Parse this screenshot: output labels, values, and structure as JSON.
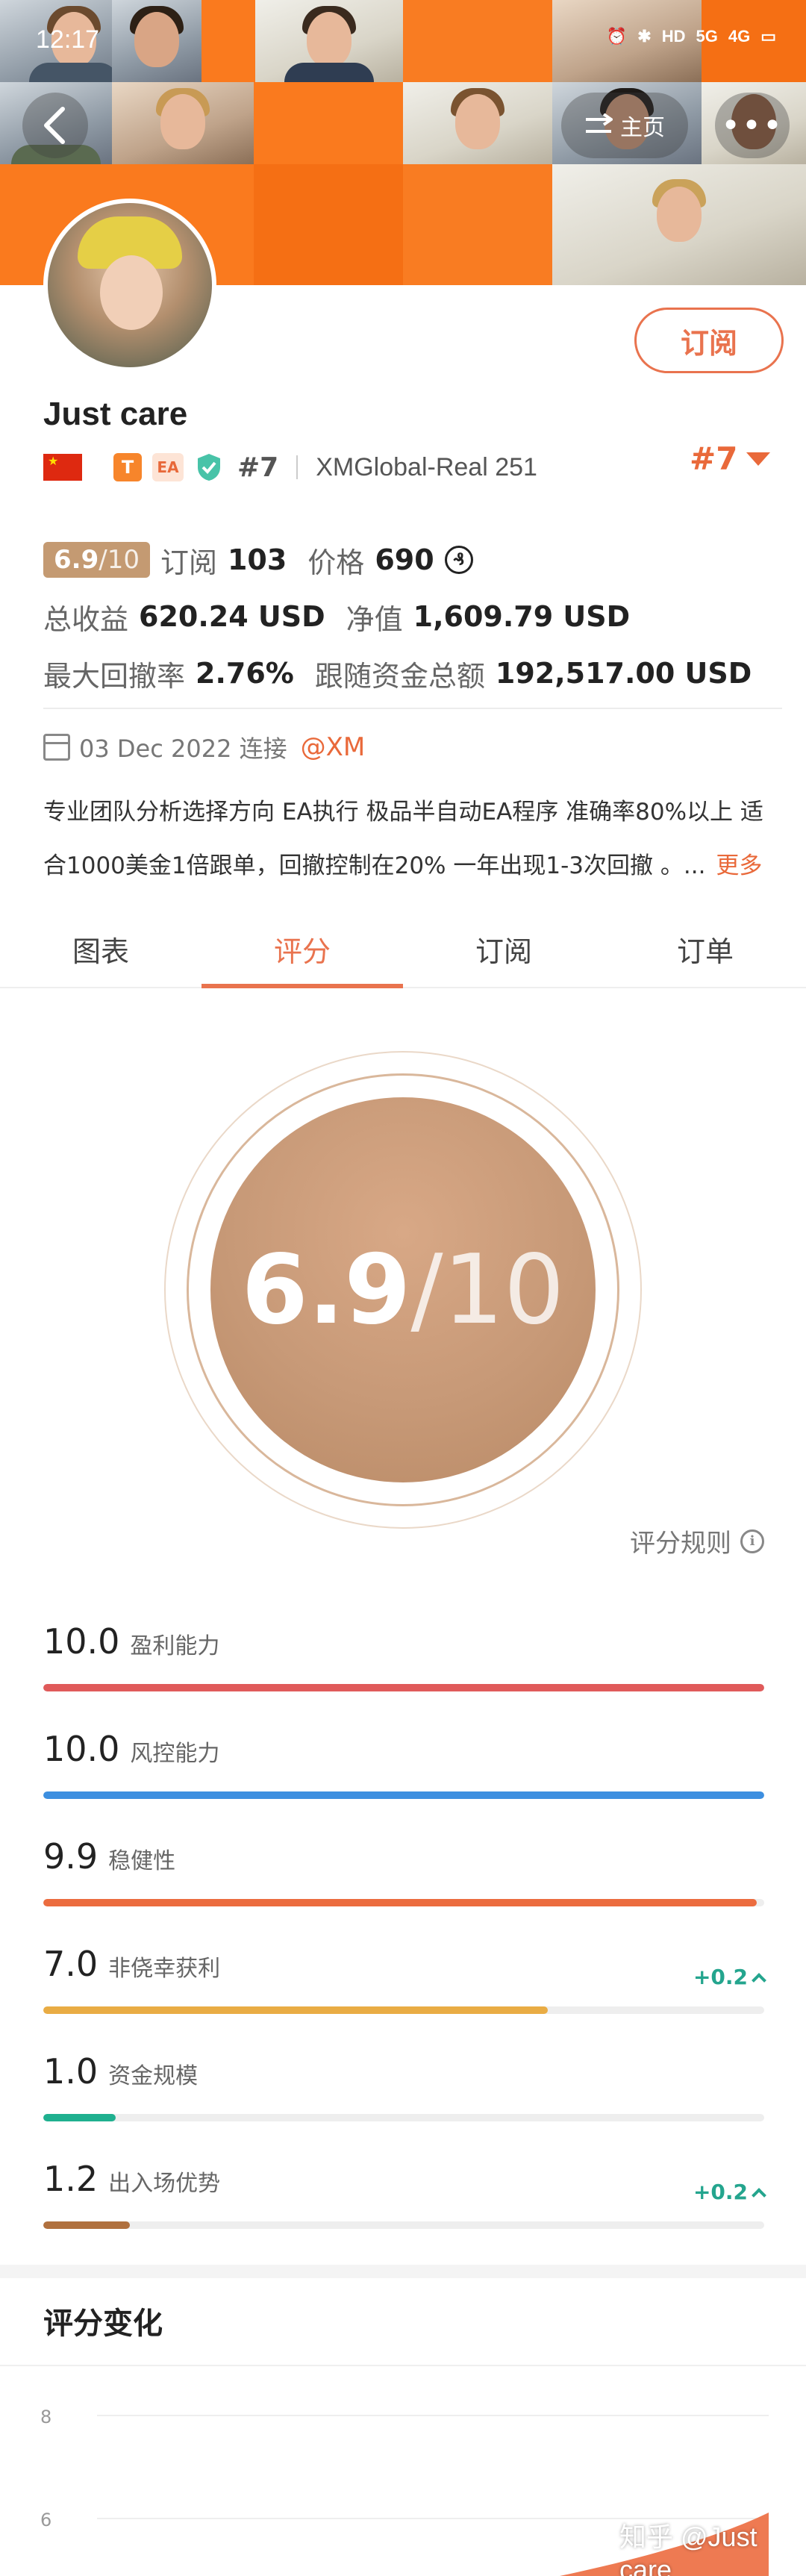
{
  "status_bar": {
    "time": "12:17",
    "icons": [
      "alarm-icon",
      "bluetooth-icon",
      "hd-icon",
      "5g-signal-icon",
      "4g-signal-icon",
      "battery-icon"
    ],
    "labels": {
      "hd": "HD",
      "g5": "5G",
      "g4": "4G"
    }
  },
  "nav": {
    "home_label": "主页"
  },
  "profile": {
    "name": "Just care",
    "subscribe_label": "订阅",
    "rank_small": "#7",
    "account": "XMGlobal-Real 251",
    "rank_big": "#7",
    "badge_t": "T",
    "badge_ea": "EA"
  },
  "stats": {
    "score": "6.9",
    "score_total": "/10",
    "subscriptions_label": "订阅",
    "subscriptions": "103",
    "price_label": "价格",
    "price": "690",
    "price_icon": "₰",
    "total_profit_label": "总收益",
    "total_profit": "620.24 USD",
    "net_value_label": "净值",
    "net_value": "1,609.79 USD",
    "max_drawdown_label": "最大回撤率",
    "max_drawdown": "2.76%",
    "follow_funds_label": "跟随资金总额",
    "follow_funds": "192,517.00 USD"
  },
  "meta": {
    "date_text": "03 Dec 2022 连接",
    "broker": "@XM"
  },
  "description": {
    "line1": "专业团队分析选择方向 EA执行 极品半自动EA程序 准确率80%以上 适",
    "line2": "合1000美金1倍跟单，回撤控制在20% 一年出现1-3次回撤 。...",
    "more": "更多"
  },
  "tabs": [
    {
      "label": "图表",
      "active": false
    },
    {
      "label": "评分",
      "active": true
    },
    {
      "label": "订阅",
      "active": false
    },
    {
      "label": "订单",
      "active": false
    }
  ],
  "rating": {
    "score": "6.9",
    "total": "/10",
    "rules_label": "评分规则"
  },
  "metrics": [
    {
      "value": "10.0",
      "label": "盈利能力",
      "fraction": 1.0,
      "color": "#e05a5a",
      "delta": ""
    },
    {
      "value": "10.0",
      "label": "风控能力",
      "fraction": 1.0,
      "color": "#3d8fe0",
      "delta": ""
    },
    {
      "value": "9.9",
      "label": "稳健性",
      "fraction": 0.99,
      "color": "#ec6c3f",
      "delta": ""
    },
    {
      "value": "7.0",
      "label": "非侥幸获利",
      "fraction": 0.7,
      "color": "#e9ac44",
      "delta": "+0.2"
    },
    {
      "value": "1.0",
      "label": "资金规模",
      "fraction": 0.1,
      "color": "#1fb08f",
      "delta": ""
    },
    {
      "value": "1.2",
      "label": "出入场优势",
      "fraction": 0.12,
      "color": "#b0703e",
      "delta": "+0.2"
    }
  ],
  "score_change": {
    "title": "评分变化"
  },
  "chart_data": {
    "type": "area",
    "y_ticks": [
      "8",
      "6"
    ],
    "ylim": [
      5.2,
      8.6
    ],
    "color": "#ec6c3f"
  },
  "watermark": "知乎 @Just care"
}
